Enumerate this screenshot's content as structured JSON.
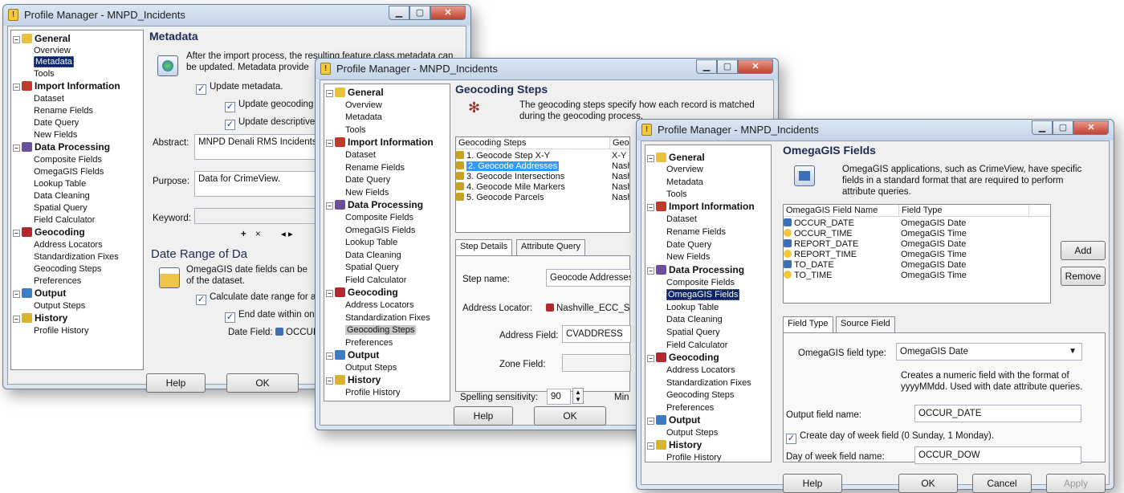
{
  "window_title": "Profile Manager -  MNPD_Incidents",
  "tree": {
    "general": "General",
    "overview": "Overview",
    "metadata": "Metadata",
    "tools": "Tools",
    "import_information": "Import Information",
    "dataset": "Dataset",
    "rename_fields": "Rename Fields",
    "date_query": "Date Query",
    "new_fields": "New Fields",
    "data_processing": "Data Processing",
    "composite_fields": "Composite Fields",
    "omegagis_fields": "OmegaGIS Fields",
    "lookup_table": "Lookup Table",
    "data_cleaning": "Data Cleaning",
    "spatial_query": "Spatial Query",
    "field_calculator": "Field Calculator",
    "geocoding": "Geocoding",
    "address_locators": "Address Locators",
    "standardization_fixes": "Standardization Fixes",
    "geocoding_steps": "Geocoding Steps",
    "preferences": "Preferences",
    "output": "Output",
    "output_steps": "Output Steps",
    "history": "History",
    "profile_history": "Profile History"
  },
  "buttons": {
    "help": "Help",
    "ok": "OK",
    "cancel": "Cancel",
    "apply": "Apply",
    "add": "Add",
    "remove": "Remove"
  },
  "w1": {
    "heading": "Metadata",
    "desc_line1": "After the import process, the resulting feature class metadata can",
    "desc_line2": "be updated.  Metadata provide",
    "update_metadata": "Update metadata.",
    "update_geocoding": "Update geocoding",
    "update_descriptive": "Update descriptive",
    "abstract_label": "Abstract:",
    "abstract_value": "MNPD Denali RMS Incidents i",
    "purpose_label": "Purpose:",
    "purpose_value": "Data for CrimeView.",
    "keyword_label": "Keyword:",
    "kw_add": "+",
    "kw_del": "×",
    "kw_nav": "◂ ▸",
    "date_range_heading": "Date Range of Da",
    "date_desc_line1": "OmegaGIS date fields can be",
    "date_desc_line2": "of the dataset.",
    "calc_date_range": "Calculate date range for a",
    "end_date_within": "End date within one",
    "date_field_label": "Date Field:",
    "date_field_value": "OCCUI"
  },
  "w2": {
    "heading": "Geocoding Steps",
    "desc_line1": "The geocoding steps specify how each record is matched",
    "desc_line2": "during the geocoding process.",
    "col1": "Geocoding Steps",
    "col2": "Geocc",
    "steps": [
      {
        "name": "1. Geocode Step X-Y",
        "loc": "X-Y Cc"
      },
      {
        "name": "2. Geocode Addresses",
        "loc": "Nashv"
      },
      {
        "name": "3. Geocode Intersections",
        "loc": "Nashv"
      },
      {
        "name": "4. Geocode Mile Markers",
        "loc": "Nashv"
      },
      {
        "name": "5. Geocode Parcels",
        "loc": "Nashv"
      }
    ],
    "tab_step_details": "Step Details",
    "tab_attribute_query": "Attribute Query",
    "step_name_label": "Step name:",
    "step_name_value": "Geocode Addresses",
    "address_locator_label": "Address Locator:",
    "address_locator_value": "Nashville_ECC_S",
    "address_field_label": "Address Field:",
    "address_field_value": "CVADDRESS",
    "zone_field_label": "Zone Field:",
    "spelling_label": "Spelling sensitivity:",
    "spelling_value": "90",
    "min_label": "Min"
  },
  "w3": {
    "heading": "OmegaGIS Fields",
    "desc_line1": "OmegaGIS applications, such as CrimeView, have specific",
    "desc_line2": "fields in a standard format that are required to perform",
    "desc_line3": "attribute queries.",
    "col1": "OmegaGIS Field Name",
    "col2": "Field Type",
    "rows": [
      {
        "name": "OCCUR_DATE",
        "type": "OmegaGIS Date",
        "icon": "calendar-icon"
      },
      {
        "name": "OCCUR_TIME",
        "type": "OmegaGIS Time",
        "icon": "clock-icon"
      },
      {
        "name": "REPORT_DATE",
        "type": "OmegaGIS Date",
        "icon": "calendar-icon"
      },
      {
        "name": "REPORT_TIME",
        "type": "OmegaGIS Time",
        "icon": "clock-icon"
      },
      {
        "name": "TO_DATE",
        "type": "OmegaGIS Date",
        "icon": "calendar-icon"
      },
      {
        "name": "TO_TIME",
        "type": "OmegaGIS Time",
        "icon": "clock-icon"
      }
    ],
    "tab_field_type": "Field Type",
    "tab_source_field": "Source Field",
    "field_type_label": "OmegaGIS field type:",
    "field_type_value": "OmegaGIS Date",
    "field_type_desc_line1": "Creates a numeric field with the format of",
    "field_type_desc_line2": "yyyyMMdd. Used with date attribute queries.",
    "output_field_label": "Output field name:",
    "output_field_value": "OCCUR_DATE",
    "create_dow": "Create day of week field (0 Sunday, 1 Monday).",
    "dow_label": "Day of week field name:",
    "dow_value": "OCCUR_DOW"
  },
  "colors": {
    "selection": "#0a246a",
    "general_icon": "#e8c13a",
    "import_icon": "#c0392b",
    "processing_icon": "#6a4f9c",
    "geocoding_icon": "#b3282d",
    "output_icon": "#3b7cc4",
    "history_icon": "#d7b42b"
  }
}
